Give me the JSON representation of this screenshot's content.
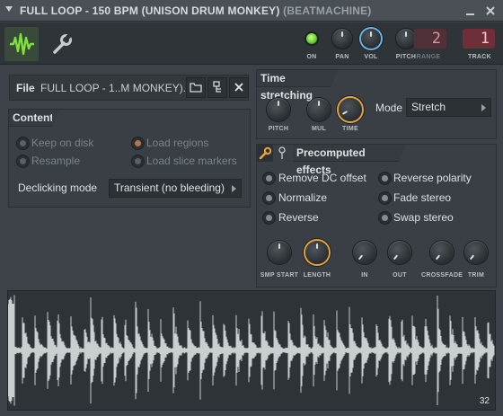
{
  "window": {
    "title": "FULL LOOP - 150 BPM (UNISON DRUM MONKEY)",
    "subtitle": "(BEATMACHINE)"
  },
  "toolbar": {
    "on_label": "ON",
    "pan_label": "PAN",
    "vol_label": "VOL",
    "pitch_label": "PITCH",
    "range_label": "RANGE",
    "range_value": "2",
    "track_label": "TRACK",
    "track_value": "1"
  },
  "file": {
    "label": "File",
    "name": "FULL LOOP - 1..M MONKEY).wav"
  },
  "content": {
    "header": "Content",
    "options": [
      {
        "label": "Keep on disk"
      },
      {
        "label": "Load regions"
      },
      {
        "label": "Resample"
      },
      {
        "label": "Load slice markers"
      }
    ],
    "declicking_label": "Declicking mode",
    "declicking_value": "Transient (no bleeding)"
  },
  "time_stretching": {
    "header": "Time stretching",
    "knobs": [
      {
        "label": "PITCH"
      },
      {
        "label": "MUL"
      },
      {
        "label": "TIME"
      }
    ],
    "mode_label": "Mode",
    "mode_value": "Stretch"
  },
  "precomputed": {
    "header": "Precomputed effects",
    "options": [
      {
        "label": "Remove DC offset"
      },
      {
        "label": "Reverse polarity"
      },
      {
        "label": "Normalize"
      },
      {
        "label": "Fade stereo"
      },
      {
        "label": "Reverse"
      },
      {
        "label": "Swap stereo"
      }
    ],
    "knobs": [
      {
        "label": "SMP START"
      },
      {
        "label": "LENGTH"
      },
      {
        "label": "IN"
      },
      {
        "label": "OUT"
      },
      {
        "label": "CROSSFADE"
      },
      {
        "label": "TRIM"
      }
    ]
  },
  "waveform": {
    "marker": "32"
  },
  "colors": {
    "accent_green": "#6bd12b",
    "accent_blue": "#68b5e8",
    "accent_orange": "#e8a33a",
    "track_red": "#6e2f38"
  }
}
